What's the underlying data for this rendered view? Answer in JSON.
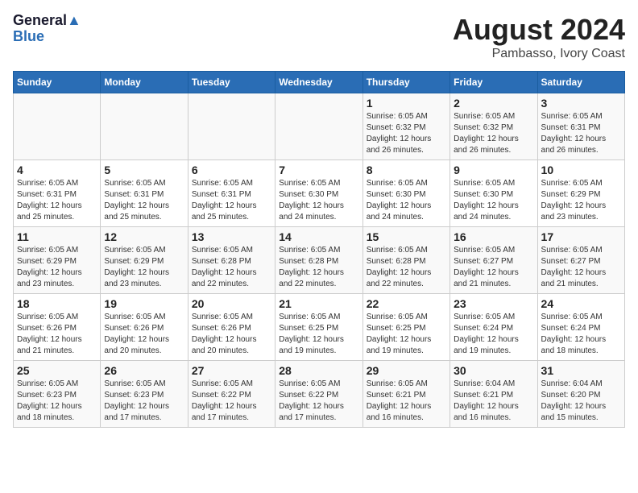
{
  "header": {
    "logo_line1": "General",
    "logo_line2": "Blue",
    "month_year": "August 2024",
    "location": "Pambasso, Ivory Coast"
  },
  "days_of_week": [
    "Sunday",
    "Monday",
    "Tuesday",
    "Wednesday",
    "Thursday",
    "Friday",
    "Saturday"
  ],
  "weeks": [
    [
      {
        "day": "",
        "text": ""
      },
      {
        "day": "",
        "text": ""
      },
      {
        "day": "",
        "text": ""
      },
      {
        "day": "",
        "text": ""
      },
      {
        "day": "1",
        "text": "Sunrise: 6:05 AM\nSunset: 6:32 PM\nDaylight: 12 hours\nand 26 minutes."
      },
      {
        "day": "2",
        "text": "Sunrise: 6:05 AM\nSunset: 6:32 PM\nDaylight: 12 hours\nand 26 minutes."
      },
      {
        "day": "3",
        "text": "Sunrise: 6:05 AM\nSunset: 6:31 PM\nDaylight: 12 hours\nand 26 minutes."
      }
    ],
    [
      {
        "day": "4",
        "text": "Sunrise: 6:05 AM\nSunset: 6:31 PM\nDaylight: 12 hours\nand 25 minutes."
      },
      {
        "day": "5",
        "text": "Sunrise: 6:05 AM\nSunset: 6:31 PM\nDaylight: 12 hours\nand 25 minutes."
      },
      {
        "day": "6",
        "text": "Sunrise: 6:05 AM\nSunset: 6:31 PM\nDaylight: 12 hours\nand 25 minutes."
      },
      {
        "day": "7",
        "text": "Sunrise: 6:05 AM\nSunset: 6:30 PM\nDaylight: 12 hours\nand 24 minutes."
      },
      {
        "day": "8",
        "text": "Sunrise: 6:05 AM\nSunset: 6:30 PM\nDaylight: 12 hours\nand 24 minutes."
      },
      {
        "day": "9",
        "text": "Sunrise: 6:05 AM\nSunset: 6:30 PM\nDaylight: 12 hours\nand 24 minutes."
      },
      {
        "day": "10",
        "text": "Sunrise: 6:05 AM\nSunset: 6:29 PM\nDaylight: 12 hours\nand 23 minutes."
      }
    ],
    [
      {
        "day": "11",
        "text": "Sunrise: 6:05 AM\nSunset: 6:29 PM\nDaylight: 12 hours\nand 23 minutes."
      },
      {
        "day": "12",
        "text": "Sunrise: 6:05 AM\nSunset: 6:29 PM\nDaylight: 12 hours\nand 23 minutes."
      },
      {
        "day": "13",
        "text": "Sunrise: 6:05 AM\nSunset: 6:28 PM\nDaylight: 12 hours\nand 22 minutes."
      },
      {
        "day": "14",
        "text": "Sunrise: 6:05 AM\nSunset: 6:28 PM\nDaylight: 12 hours\nand 22 minutes."
      },
      {
        "day": "15",
        "text": "Sunrise: 6:05 AM\nSunset: 6:28 PM\nDaylight: 12 hours\nand 22 minutes."
      },
      {
        "day": "16",
        "text": "Sunrise: 6:05 AM\nSunset: 6:27 PM\nDaylight: 12 hours\nand 21 minutes."
      },
      {
        "day": "17",
        "text": "Sunrise: 6:05 AM\nSunset: 6:27 PM\nDaylight: 12 hours\nand 21 minutes."
      }
    ],
    [
      {
        "day": "18",
        "text": "Sunrise: 6:05 AM\nSunset: 6:26 PM\nDaylight: 12 hours\nand 21 minutes."
      },
      {
        "day": "19",
        "text": "Sunrise: 6:05 AM\nSunset: 6:26 PM\nDaylight: 12 hours\nand 20 minutes."
      },
      {
        "day": "20",
        "text": "Sunrise: 6:05 AM\nSunset: 6:26 PM\nDaylight: 12 hours\nand 20 minutes."
      },
      {
        "day": "21",
        "text": "Sunrise: 6:05 AM\nSunset: 6:25 PM\nDaylight: 12 hours\nand 19 minutes."
      },
      {
        "day": "22",
        "text": "Sunrise: 6:05 AM\nSunset: 6:25 PM\nDaylight: 12 hours\nand 19 minutes."
      },
      {
        "day": "23",
        "text": "Sunrise: 6:05 AM\nSunset: 6:24 PM\nDaylight: 12 hours\nand 19 minutes."
      },
      {
        "day": "24",
        "text": "Sunrise: 6:05 AM\nSunset: 6:24 PM\nDaylight: 12 hours\nand 18 minutes."
      }
    ],
    [
      {
        "day": "25",
        "text": "Sunrise: 6:05 AM\nSunset: 6:23 PM\nDaylight: 12 hours\nand 18 minutes."
      },
      {
        "day": "26",
        "text": "Sunrise: 6:05 AM\nSunset: 6:23 PM\nDaylight: 12 hours\nand 17 minutes."
      },
      {
        "day": "27",
        "text": "Sunrise: 6:05 AM\nSunset: 6:22 PM\nDaylight: 12 hours\nand 17 minutes."
      },
      {
        "day": "28",
        "text": "Sunrise: 6:05 AM\nSunset: 6:22 PM\nDaylight: 12 hours\nand 17 minutes."
      },
      {
        "day": "29",
        "text": "Sunrise: 6:05 AM\nSunset: 6:21 PM\nDaylight: 12 hours\nand 16 minutes."
      },
      {
        "day": "30",
        "text": "Sunrise: 6:04 AM\nSunset: 6:21 PM\nDaylight: 12 hours\nand 16 minutes."
      },
      {
        "day": "31",
        "text": "Sunrise: 6:04 AM\nSunset: 6:20 PM\nDaylight: 12 hours\nand 15 minutes."
      }
    ]
  ]
}
